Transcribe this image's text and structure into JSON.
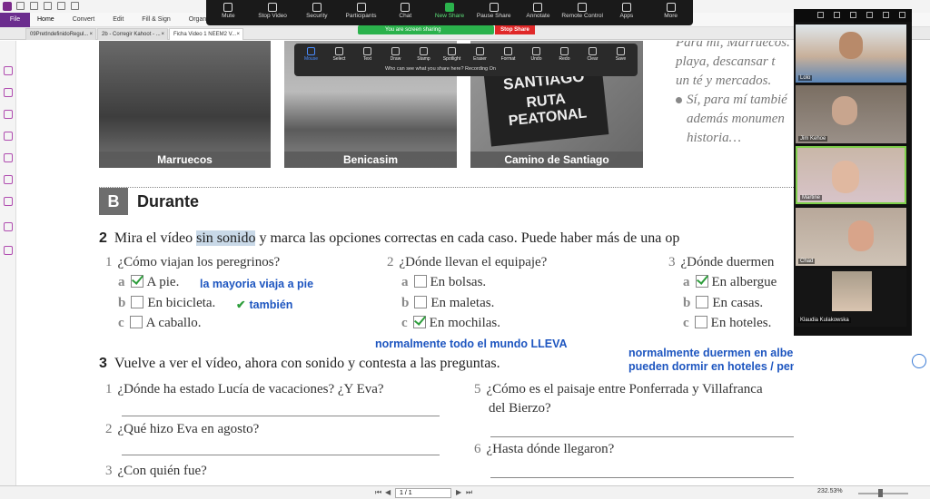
{
  "app": {
    "ribbon_tabs": [
      "File",
      "Home",
      "Convert",
      "Edit",
      "Fill & Sign",
      "Organize"
    ]
  },
  "tabs": [
    {
      "label": "09PretIndefinidoRegul...",
      "active": false
    },
    {
      "label": "2b - Corregir Kahoot - ...",
      "active": false
    },
    {
      "label": "Ficha Video 1 NEEM2 V...",
      "active": true
    }
  ],
  "zoom": {
    "toolbar": [
      {
        "label": "Mute",
        "icon": "microphone-icon"
      },
      {
        "label": "Stop Video",
        "icon": "camera-icon"
      },
      {
        "label": "Security",
        "icon": "shield-icon"
      },
      {
        "label": "Participants",
        "icon": "people-icon",
        "count": "5"
      },
      {
        "label": "Chat",
        "icon": "chat-icon"
      },
      {
        "label": "New Share",
        "icon": "share-icon",
        "green": true
      },
      {
        "label": "Pause Share",
        "icon": "pause-icon"
      },
      {
        "label": "Annotate",
        "icon": "pencil-icon"
      },
      {
        "label": "Remote Control",
        "icon": "mouse-icon"
      },
      {
        "label": "Apps",
        "icon": "apps-icon"
      },
      {
        "label": "More",
        "icon": "more-icon"
      }
    ],
    "sharing_banner": "You are screen sharing",
    "stop_share": "Stop Share",
    "annotate_tools": [
      "Mouse",
      "Select",
      "Text",
      "Draw",
      "Stamp",
      "Spotlight",
      "Eraser",
      "Format",
      "Undo",
      "Redo",
      "Clear",
      "Save"
    ],
    "annotate_note": "Who can see what you share here? Recording On",
    "participants": [
      "Lolo",
      "Jim Kehoe",
      "Martine",
      "Chad",
      "Klaudia Kulakowska"
    ]
  },
  "doc": {
    "photos": [
      "Marruecos",
      "Benicasim",
      "Camino de Santiago"
    ],
    "sign_text": [
      "SANTIAGO",
      "RUTA PEATONAL"
    ],
    "right_text": {
      "line1": "Para mí, Marruecos.",
      "line2": "playa, descansar t",
      "line3": "un té y mercados.",
      "bullet2_l1": "Sí, para mí tambié",
      "bullet2_l2": "además monumen",
      "bullet2_l3": "historia…"
    },
    "section": {
      "letter": "B",
      "title": "Durante"
    },
    "q2": {
      "num": "2",
      "pre": "Mira el vídeo ",
      "highlight": "sin sonido",
      "post": " y marca las opciones correctas en cada caso. Puede haber más de una op",
      "items": [
        {
          "num": "1",
          "q": "¿Cómo viajan los peregrinos?",
          "opts": [
            {
              "l": "a",
              "t": "A pie.",
              "checked": true
            },
            {
              "l": "b",
              "t": "En bicicleta.",
              "checked": false
            },
            {
              "l": "c",
              "t": "A caballo.",
              "checked": false
            }
          ]
        },
        {
          "num": "2",
          "q": "¿Dónde llevan el equipaje?",
          "opts": [
            {
              "l": "a",
              "t": "En bolsas.",
              "checked": false
            },
            {
              "l": "b",
              "t": "En maletas.",
              "checked": false
            },
            {
              "l": "c",
              "t": "En mochilas.",
              "checked": true
            }
          ]
        },
        {
          "num": "3",
          "q": "¿Dónde duermen",
          "opts": [
            {
              "l": "a",
              "t": "En albergue",
              "checked": true
            },
            {
              "l": "b",
              "t": "En casas.",
              "checked": false
            },
            {
              "l": "c",
              "t": "En hoteles.",
              "checked": false
            }
          ]
        }
      ]
    },
    "annotations": {
      "n1": "la mayoria viaja a pie",
      "n2": "también",
      "n3": "normalmente todo el mundo LLEVA",
      "n4a": "normalmente duermen en albergues pero",
      "n4b": "pueden dormir en hoteles / pensiones"
    },
    "q3": {
      "num": "3",
      "text": "Vuelve a ver el vídeo, ahora con sonido y contesta a las preguntas.",
      "items": [
        {
          "num": "1",
          "q": "¿Dónde ha estado Lucía de vacaciones? ¿Y Eva?"
        },
        {
          "num": "2",
          "q": "¿Qué hizo Eva en agosto?"
        },
        {
          "num": "3",
          "q": "¿Con quién fue?"
        },
        {
          "num": "5",
          "q": "¿Cómo es el paisaje entre Ponferrada y Villafranca",
          "q2": "del Bierzo?"
        },
        {
          "num": "6",
          "q": "¿Hasta dónde llegaron?"
        }
      ]
    }
  },
  "status": {
    "page": "1 / 1",
    "zoom": "232.53%"
  }
}
